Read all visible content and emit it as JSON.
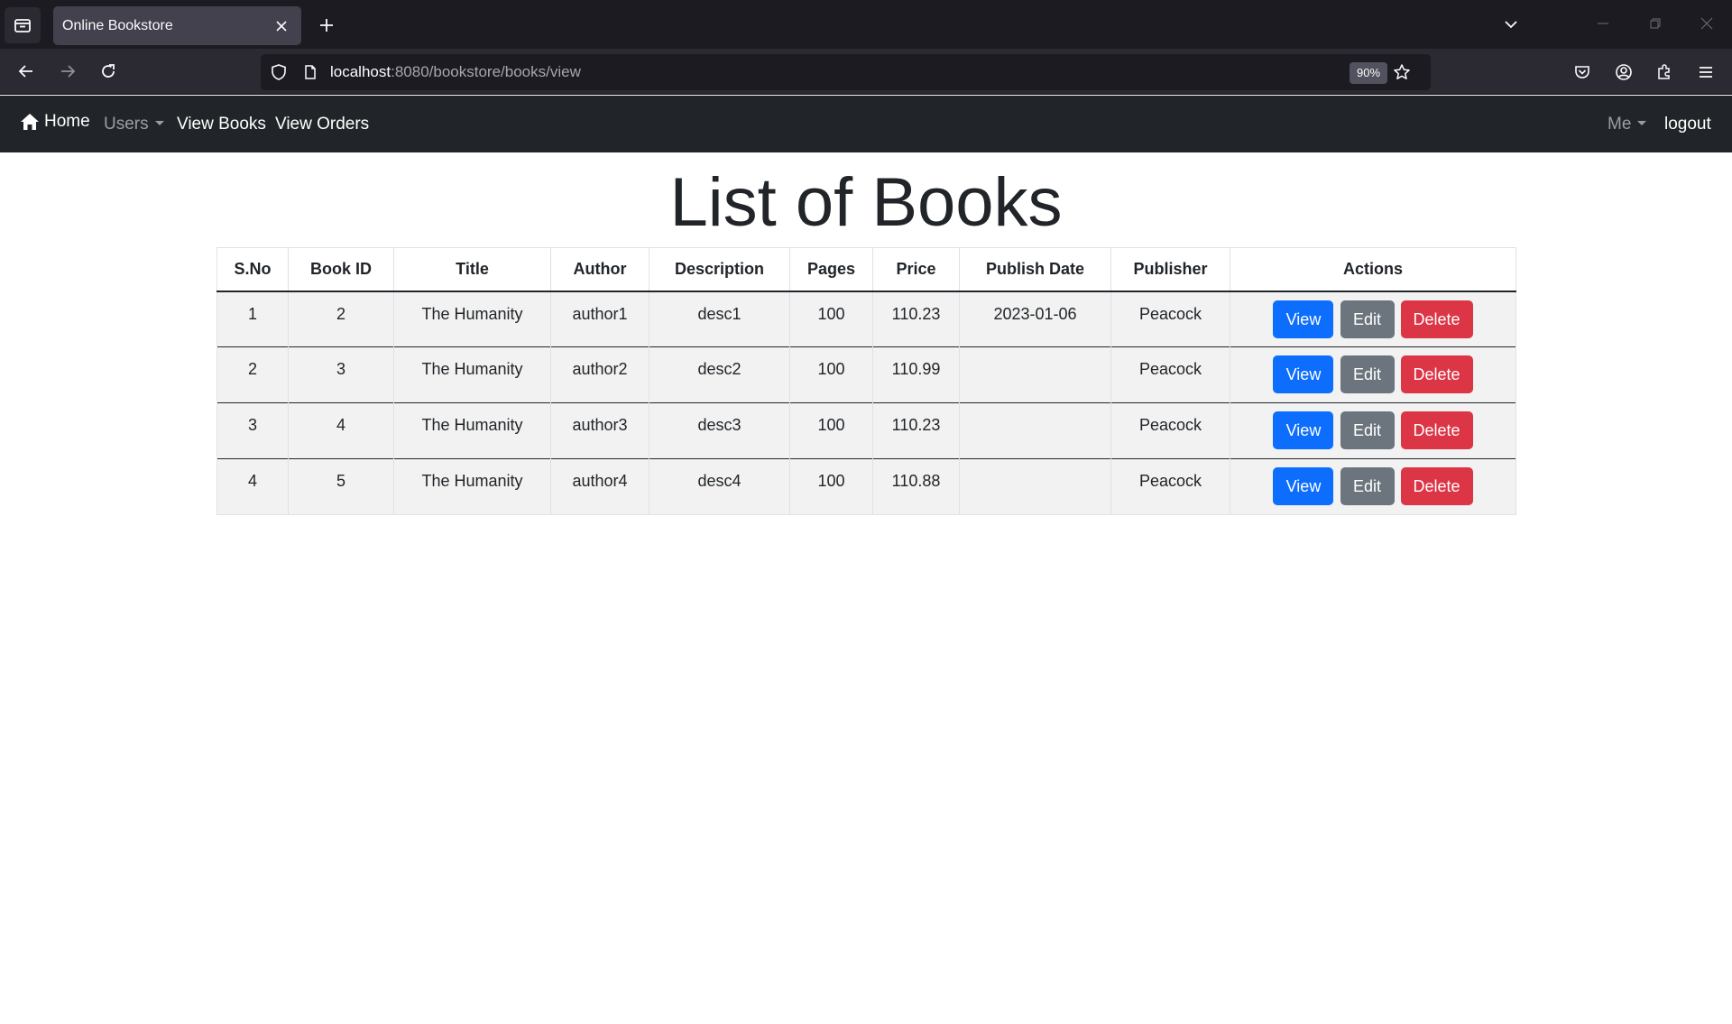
{
  "browser": {
    "tab_title": "Online Bookstore",
    "url_host": "localhost",
    "url_rest": ":8080/bookstore/books/view",
    "zoom": "90%"
  },
  "site_nav": {
    "home": "Home",
    "users": "Users",
    "view_books": "View Books",
    "view_orders": "View Orders",
    "me": "Me",
    "logout": "logout"
  },
  "page": {
    "title": "List of Books"
  },
  "table": {
    "headers": [
      "S.No",
      "Book ID",
      "Title",
      "Author",
      "Description",
      "Pages",
      "Price",
      "Publish Date",
      "Publisher",
      "Actions"
    ],
    "rows": [
      {
        "sno": "1",
        "book_id": "2",
        "title": "The Humanity",
        "author": "author1",
        "description": "desc1",
        "pages": "100",
        "price": "110.23",
        "publish_date": "2023-01-06",
        "publisher": "Peacock"
      },
      {
        "sno": "2",
        "book_id": "3",
        "title": "The Humanity",
        "author": "author2",
        "description": "desc2",
        "pages": "100",
        "price": "110.99",
        "publish_date": "",
        "publisher": "Peacock"
      },
      {
        "sno": "3",
        "book_id": "4",
        "title": "The Humanity",
        "author": "author3",
        "description": "desc3",
        "pages": "100",
        "price": "110.23",
        "publish_date": "",
        "publisher": "Peacock"
      },
      {
        "sno": "4",
        "book_id": "5",
        "title": "The Humanity",
        "author": "author4",
        "description": "desc4",
        "pages": "100",
        "price": "110.88",
        "publish_date": "",
        "publisher": "Peacock"
      }
    ],
    "actions": {
      "view": "View",
      "edit": "Edit",
      "delete": "Delete"
    }
  },
  "colors": {
    "primary": "#0d6efd",
    "secondary": "#6c757d",
    "danger": "#dc3545",
    "navbar": "#212529"
  }
}
